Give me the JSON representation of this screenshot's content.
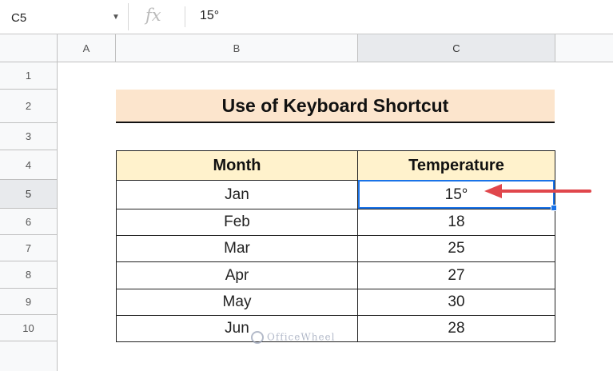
{
  "formula_bar": {
    "name_box": "C5",
    "fx_label": "fx",
    "formula_value": "15°"
  },
  "column_headers": [
    "A",
    "B",
    "C"
  ],
  "row_headers": [
    "1",
    "2",
    "3",
    "4",
    "5",
    "6",
    "7",
    "8",
    "9",
    "10"
  ],
  "sheet": {
    "title": "Use of Keyboard Shortcut",
    "table_headers": [
      "Month",
      "Temperature"
    ],
    "rows": [
      {
        "month": "Jan",
        "temperature": "15°"
      },
      {
        "month": "Feb",
        "temperature": "18"
      },
      {
        "month": "Mar",
        "temperature": "25"
      },
      {
        "month": "Apr",
        "temperature": "27"
      },
      {
        "month": "May",
        "temperature": "30"
      },
      {
        "month": "Jun",
        "temperature": "28"
      }
    ]
  },
  "selected_cell": "C5",
  "watermark": "OfficeWheel",
  "colors": {
    "title_fill": "#fce5cd",
    "header_fill": "#fff2cc",
    "selection": "#1a73e8",
    "arrow": "#e0474c"
  }
}
